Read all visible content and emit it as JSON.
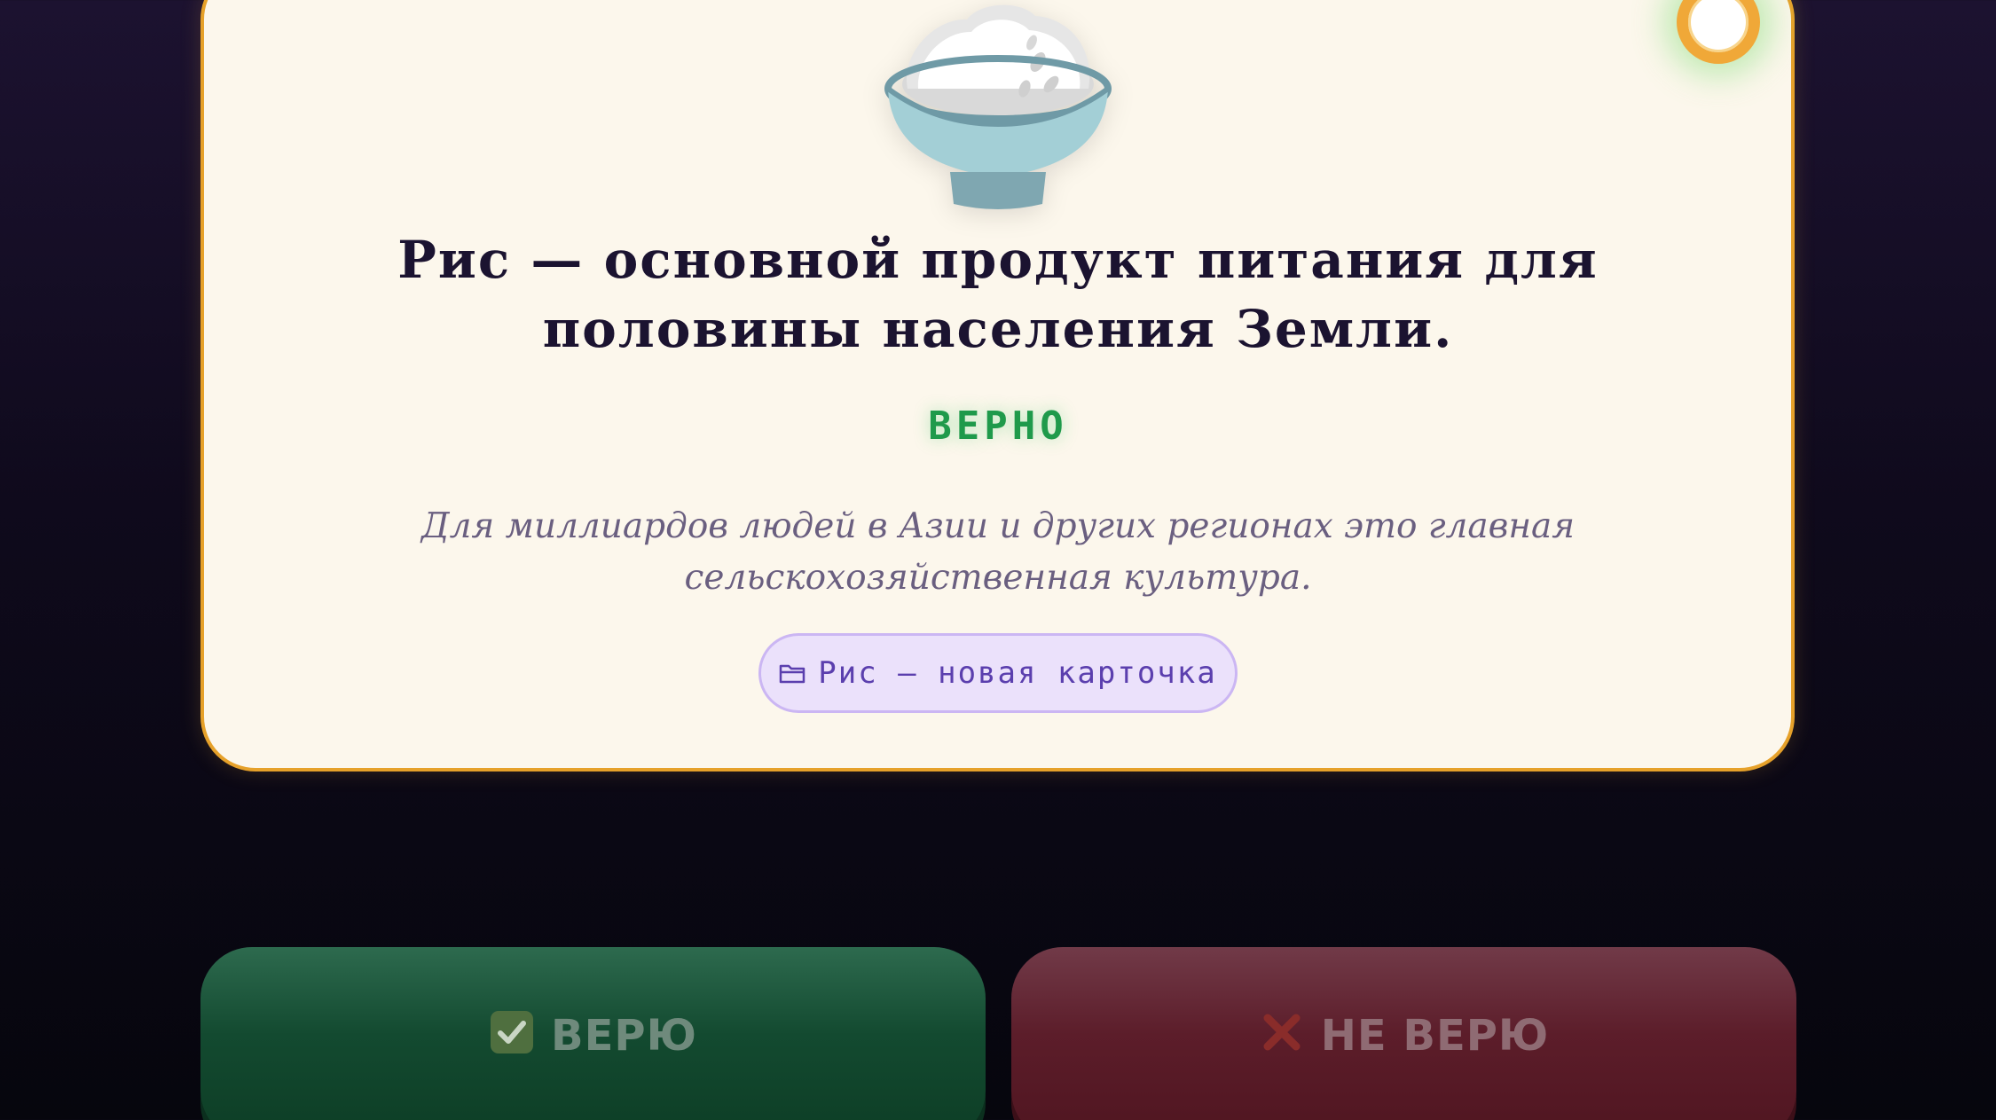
{
  "card": {
    "emoji_icon": "rice-bowl-icon",
    "statement": "Рис — основной продукт питания для половины населения Земли.",
    "verdict": "ВЕРНО",
    "explanation": "Для миллиардов людей в Азии и других регионах это главная сельскохозяйственная культура.",
    "new_card_label": "Рис – новая карточка",
    "new_card_icon": "folder-icon"
  },
  "answers": {
    "true_label": "ВЕРЮ",
    "true_icon": "check-mark-button-icon",
    "false_label": "НЕ ВЕРЮ",
    "false_icon": "cross-mark-icon"
  },
  "colors": {
    "background": "#0f0a1c",
    "card": "#fcf7ec",
    "card_border": "#e6a12a",
    "verdict_true": "#1f9a4b",
    "true_button": "#134a30",
    "false_button": "#5c1d2a",
    "tag_bg": "#ebe1fb",
    "tag_text": "#5b3fae"
  }
}
